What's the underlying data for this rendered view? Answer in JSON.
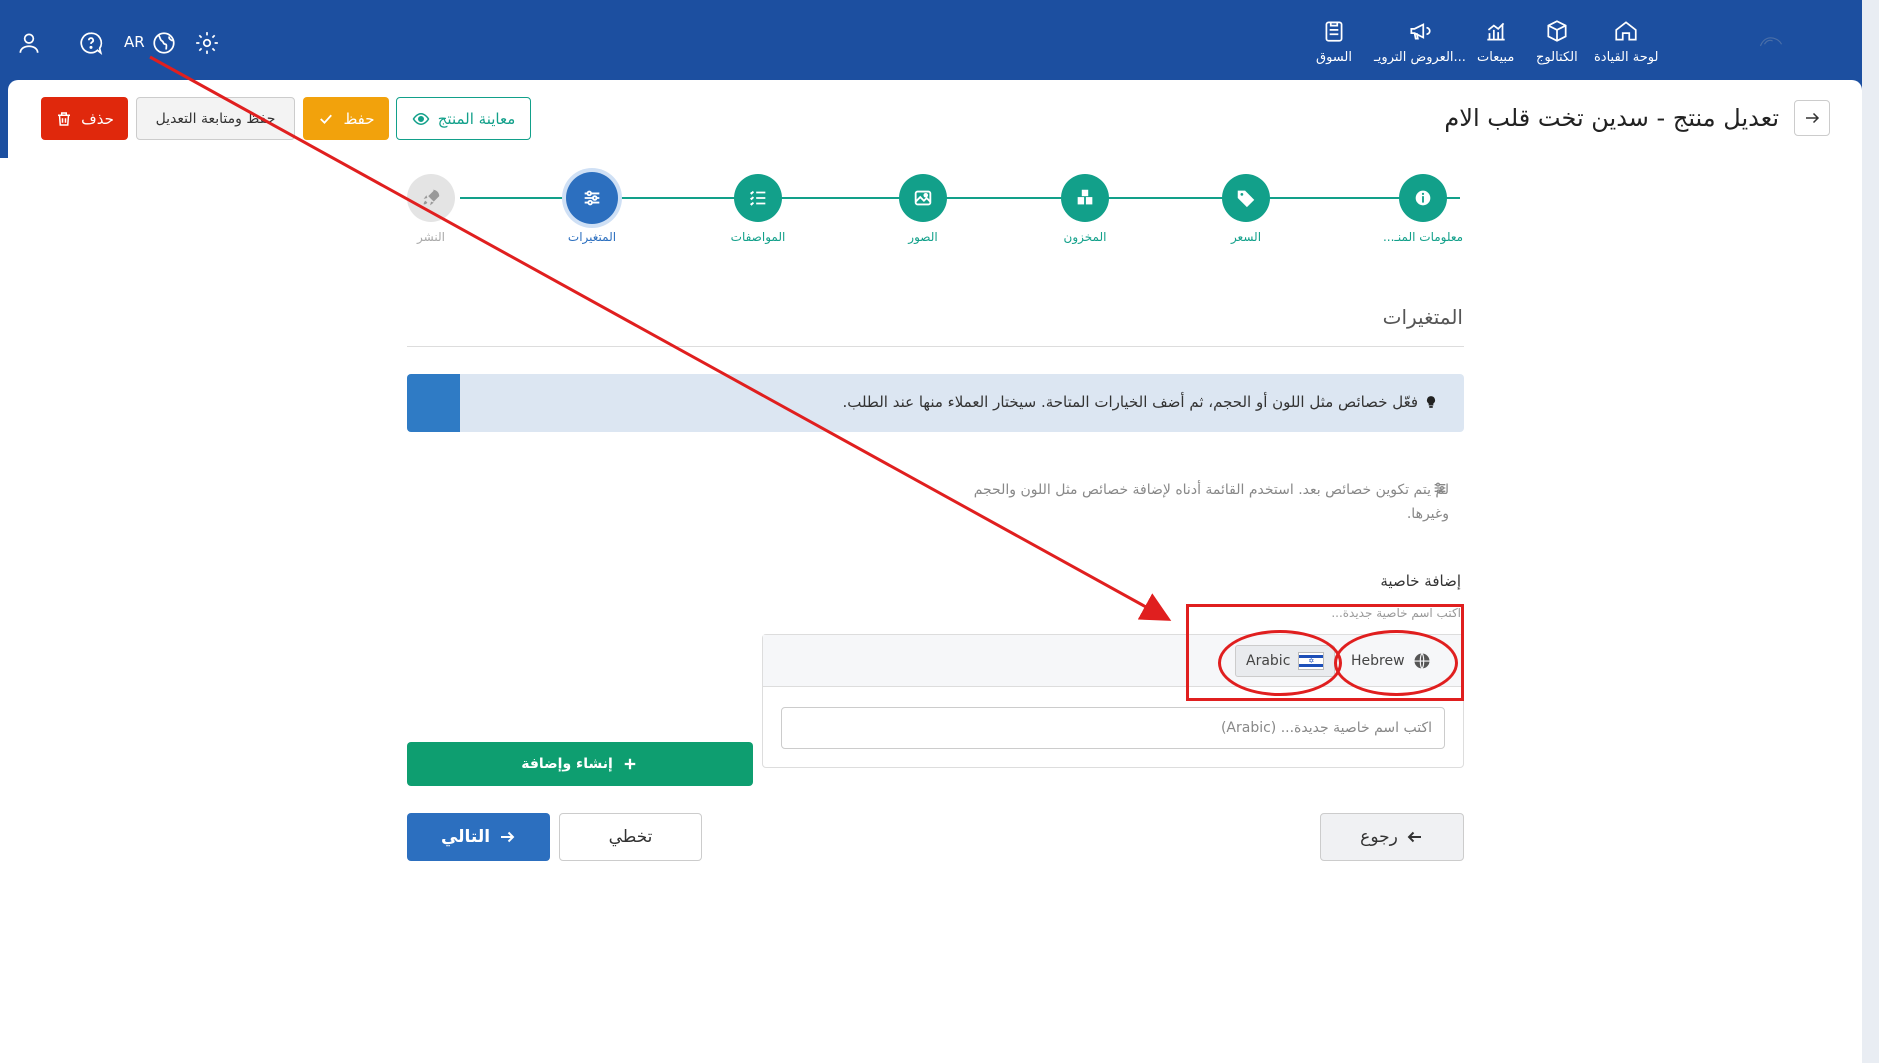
{
  "nav": {
    "items": [
      {
        "label": "لوحة القيادة",
        "icon": "home-icon"
      },
      {
        "label": "الكتالوج",
        "icon": "box-icon"
      },
      {
        "label": "مبيعات",
        "icon": "chart-icon"
      },
      {
        "label": "العروض الترويـ...",
        "icon": "megaphone-icon"
      },
      {
        "label": "السوق",
        "icon": "clipboard-icon"
      }
    ],
    "lang_code": "AR"
  },
  "toolbar": {
    "delete_label": "حذف",
    "save_continue_label": "حفظ ومتابعة التعديل",
    "save_label": "حفظ",
    "preview_label": "معاينة المنتج"
  },
  "page": {
    "title": "تعديل منتج - سدين تخت قلب الام"
  },
  "steps": [
    {
      "label": "معلومات المنـ...",
      "state": "done",
      "icon": "info-icon"
    },
    {
      "label": "السعر",
      "state": "done",
      "icon": "tag-icon"
    },
    {
      "label": "المخزون",
      "state": "done",
      "icon": "boxes-icon"
    },
    {
      "label": "الصور",
      "state": "done",
      "icon": "image-icon"
    },
    {
      "label": "المواصفات",
      "state": "done",
      "icon": "list-icon"
    },
    {
      "label": "المتغيرات",
      "state": "active",
      "icon": "sliders-icon"
    },
    {
      "label": "النشر",
      "state": "disabled",
      "icon": "rocket-icon"
    }
  ],
  "variants": {
    "section_title": "المتغيرات",
    "info_text": "فعّل خصائص مثل اللون أو الحجم، ثم أضف الخيارات المتاحة. سيختار العملاء منها عند الطلب.",
    "empty_text": "لم يتم تكوين خصائص بعد. استخدم القائمة أدناه لإضافة خصائص مثل اللون والحجم وغيرها.",
    "add_attr_label": "إضافة خاصية",
    "add_attr_hint": "اكتب اسم خاصية جديدة...",
    "languages": [
      {
        "label": "Hebrew",
        "selected": false
      },
      {
        "label": "Arabic",
        "selected": true
      }
    ],
    "input_placeholder": "اكتب اسم خاصية جديدة... (Arabic)",
    "create_button": "إنشاء وإضافة"
  },
  "footer": {
    "next_label": "التالي",
    "skip_label": "تخطي",
    "back_label": "رجوع"
  },
  "colors": {
    "topbar": "#1c4fa0",
    "step_done": "#12a08a",
    "step_active": "#2c6fbf",
    "annotation": "#e01f1f"
  }
}
